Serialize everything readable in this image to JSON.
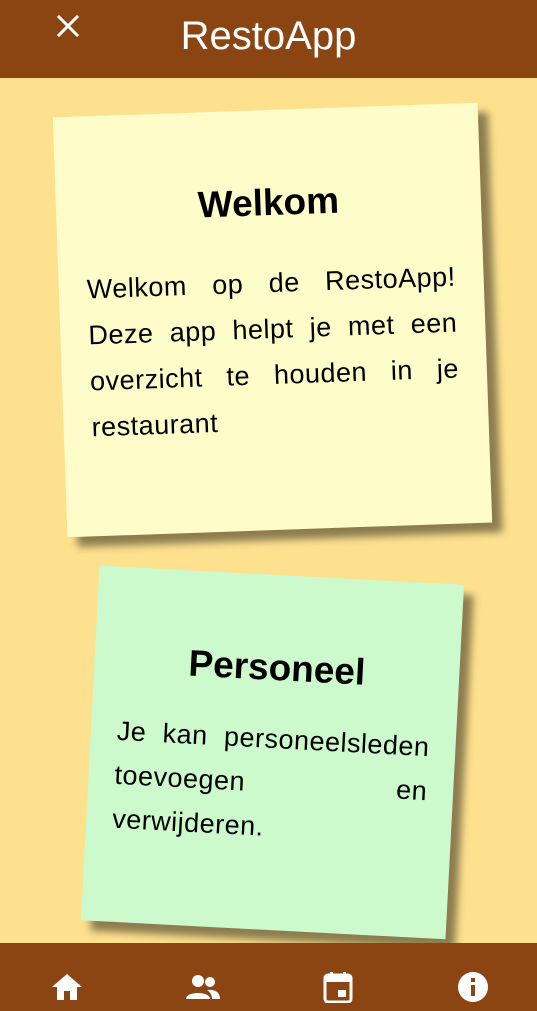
{
  "header": {
    "title": "RestoApp",
    "close_icon": "close-icon"
  },
  "cards": [
    {
      "title": "Welkom",
      "body": "Welkom op de RestoApp! Deze app helpt je met een overzicht te houden in je restaurant",
      "color": "#FEFCC8"
    },
    {
      "title": "Personeel",
      "body": "Je kan personeelsleden toevoegen en verwijderen.",
      "color": "#CCFACC"
    }
  ],
  "bottom_nav": {
    "items": [
      "home-icon",
      "people-icon",
      "calendar-icon",
      "info-icon"
    ]
  },
  "colors": {
    "bar": "#8B4513",
    "background": "#FDE18F"
  }
}
